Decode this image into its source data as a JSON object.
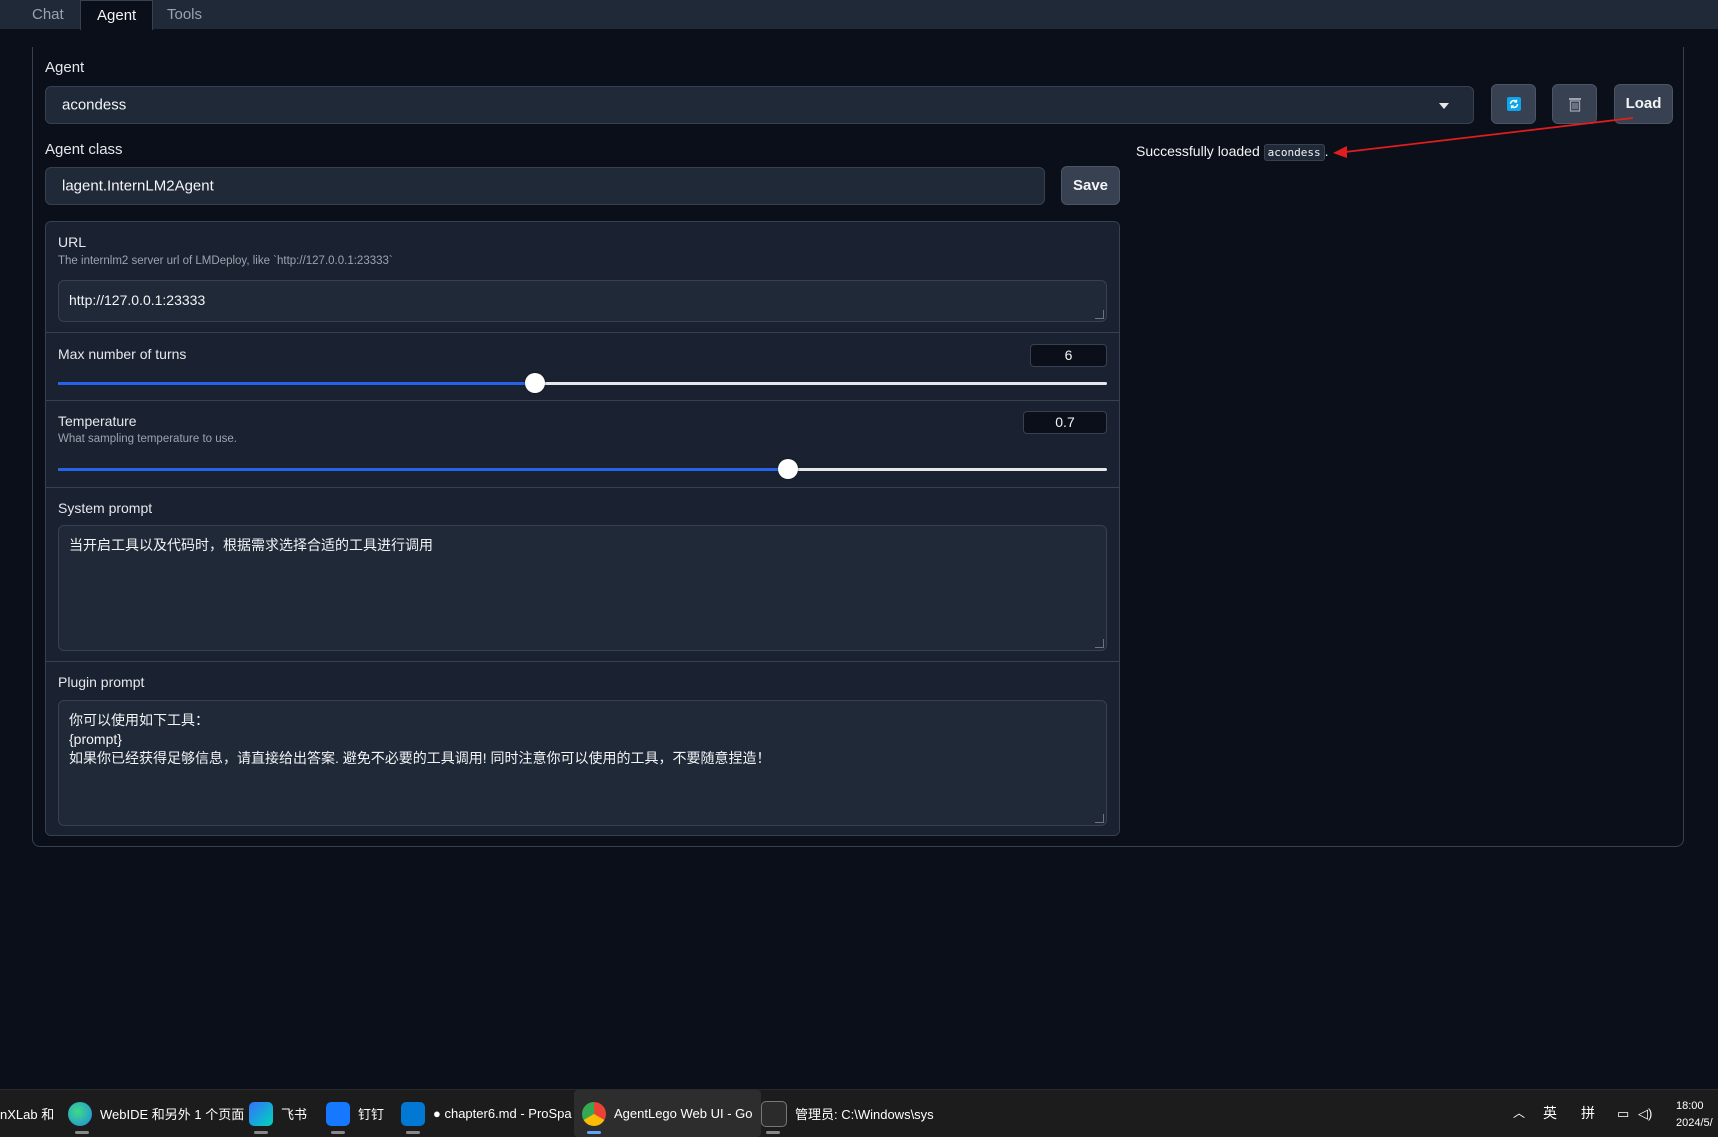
{
  "tabs": [
    {
      "label": "Chat"
    },
    {
      "label": "Agent"
    },
    {
      "label": "Tools"
    }
  ],
  "agent": {
    "label": "Agent",
    "selected": "acondess",
    "refresh_icon": "refresh-icon",
    "delete_icon": "trash-icon",
    "load_label": "Load"
  },
  "agent_class": {
    "label": "Agent class",
    "value": "lagent.InternLM2Agent",
    "save_label": "Save"
  },
  "status": {
    "prefix": "Successfully loaded",
    "name": "acondess",
    "suffix": ".",
    "annotation_color": "#e11d1d"
  },
  "url": {
    "title": "URL",
    "info": "The internlm2 server url of LMDeploy, like `http://127.0.0.1:23333`",
    "value": "http://127.0.0.1:23333"
  },
  "max_turns": {
    "title": "Max number of turns",
    "value": "6",
    "level_fraction": 0.455
  },
  "temperature": {
    "title": "Temperature",
    "info": "What sampling temperature to use.",
    "value": "0.7",
    "level_fraction": 0.696
  },
  "system_prompt": {
    "title": "System prompt",
    "value": "当开启工具以及代码时，根据需求选择合适的工具进行调用"
  },
  "plugin_prompt": {
    "title": "Plugin prompt",
    "line1": "你可以使用如下工具：",
    "line2": "{prompt}",
    "line3": "如果你已经获得足够信息，请直接给出答案. 避免不必要的工具调用! 同时注意你可以使用的工具，不要随意捏造！"
  },
  "colors": {
    "accent": "#2563eb",
    "background": "#0b0f19",
    "panel": "#1f2937"
  },
  "taskbar": {
    "items": [
      {
        "label": "nXLab 和",
        "icon": "app-icon"
      },
      {
        "label": "WebIDE 和另外 1 个页面",
        "icon": "edge-icon"
      },
      {
        "label": "飞书",
        "icon": "feishu-icon"
      },
      {
        "label": "钉钉",
        "icon": "dingtalk-icon"
      },
      {
        "label": "● chapter6.md - ProSpa",
        "icon": "vscode-icon"
      },
      {
        "label": "AgentLego Web UI - Go",
        "icon": "chrome-icon"
      },
      {
        "label": "管理员: C:\\Windows\\sys",
        "icon": "terminal-icon"
      }
    ],
    "tray_lang": "英",
    "tray_ime": "拼",
    "time": "18:00",
    "date": "2024/5/"
  }
}
